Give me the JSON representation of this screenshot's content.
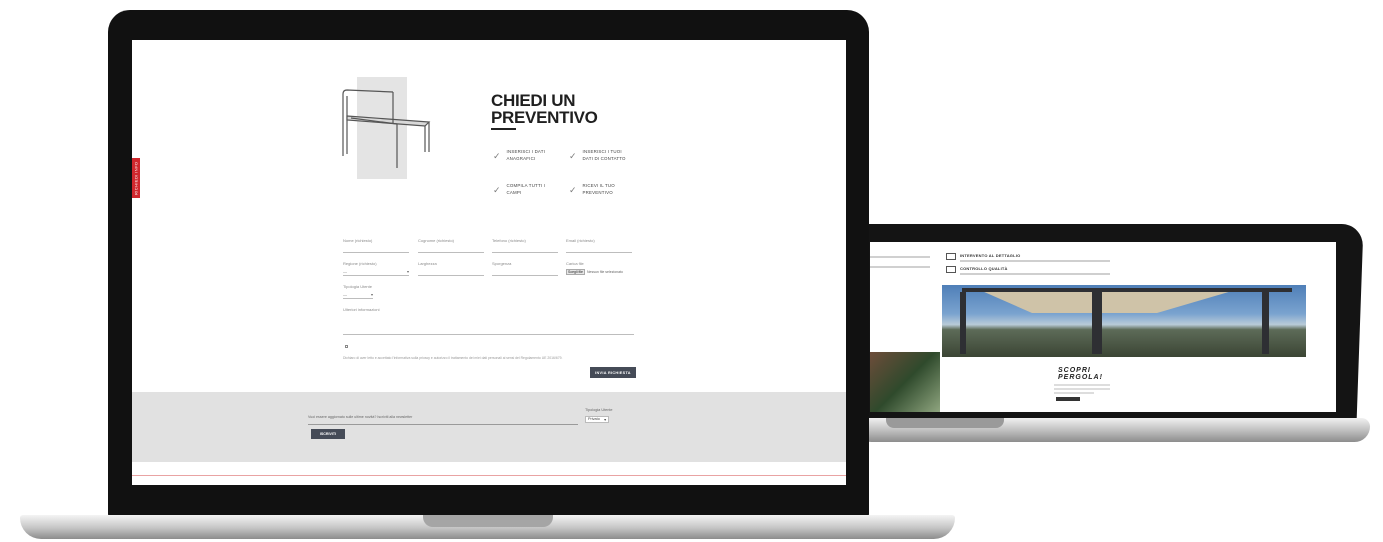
{
  "front": {
    "side_tab": "RICHIEDI INFO",
    "hero": {
      "title_line1": "CHIEDI UN",
      "title_line2": "PREVENTIVO"
    },
    "steps": [
      {
        "label": "INSERISCI I DATI ANAGRAFICI"
      },
      {
        "label": "INSERISCI I TUOI DATI DI CONTATTO"
      },
      {
        "label": "COMPILA TUTTI I CAMPI"
      },
      {
        "label": "RICEVI IL TUO PREVENTIVO"
      }
    ],
    "form": {
      "row1": [
        "Nome (richiesto)",
        "Cognome (richiesto)",
        "Telefono (richiesto)",
        "Email (richiesto)"
      ],
      "row2": [
        "Regione (richiesto)",
        "Larghezza",
        "Sporgenza",
        "Carica file"
      ],
      "region_value": "—",
      "file_button": "Scegli file",
      "file_text": "Nessun file selezionato",
      "type_label": "Tipologia Utente",
      "type_value": "—",
      "message_label": "Ulteriori informazioni",
      "privacy": "Dichiaro di aver letto e accettato l'informativa sulla privacy e autorizzo il trattamento dei miei dati personali ai sensi del Regolamento UE 2016/679.",
      "submit_label": "INVIA RICHIESTA"
    },
    "newsletter": {
      "label": "Vuoi essere aggiornato sulle ultime novità? Iscriviti alla newsletter",
      "type_label": "Tipologia Utente",
      "type_value": "Privato",
      "button_label": "ISCRIVITI"
    }
  },
  "back": {
    "feature1_title": "INTERVENTO AL DETTAGLIO",
    "feature2_title": "CONTROLLO QUALITÀ",
    "promo_title_line1": "SCOPRI",
    "promo_title_line2": "PERGOLA!"
  },
  "colors": {
    "accent_red": "#d1272d",
    "button_dark": "#454b57",
    "band_grey": "#e1e1e1"
  }
}
